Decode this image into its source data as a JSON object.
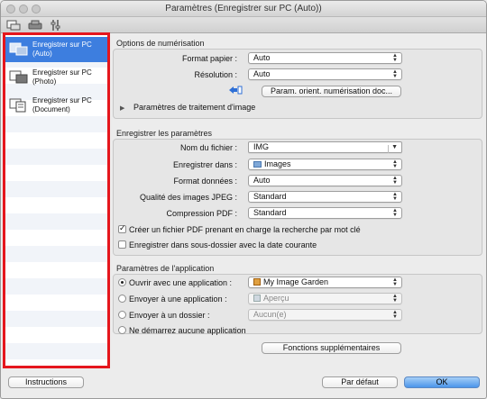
{
  "window": {
    "title": "Paramètres (Enregistrer sur PC (Auto))"
  },
  "sidebar": {
    "items": [
      {
        "label": "Enregistrer sur PC (Auto)",
        "selected": true
      },
      {
        "label": "Enregistrer sur PC (Photo)",
        "selected": false
      },
      {
        "label": "Enregistrer sur PC (Document)",
        "selected": false
      }
    ]
  },
  "scan_options": {
    "title": "Options de numérisation",
    "paper_format_label": "Format papier :",
    "paper_format_value": "Auto",
    "resolution_label": "Résolution :",
    "resolution_value": "Auto",
    "orientation_button": "Param. orient. numérisation doc...",
    "image_processing_label": "Paramètres de traitement d'image"
  },
  "save_settings": {
    "title": "Enregistrer les paramètres",
    "filename_label": "Nom du fichier :",
    "filename_value": "IMG",
    "save_in_label": "Enregistrer dans :",
    "save_in_value": "Images",
    "data_format_label": "Format données :",
    "data_format_value": "Auto",
    "jpeg_quality_label": "Qualité des images JPEG :",
    "jpeg_quality_value": "Standard",
    "pdf_compression_label": "Compression PDF :",
    "pdf_compression_value": "Standard",
    "keyword_pdf_label": "Créer un fichier PDF prenant en charge la recherche par mot clé",
    "keyword_pdf_checked": true,
    "date_subfolder_label": "Enregistrer dans sous-dossier avec la date courante",
    "date_subfolder_checked": false
  },
  "app_settings": {
    "title": "Paramètres de l'application",
    "open_with_label": "Ouvrir avec une application :",
    "open_with_value": "My Image Garden",
    "send_app_label": "Envoyer à une application :",
    "send_app_value": "Aperçu",
    "send_folder_label": "Envoyer à un dossier :",
    "send_folder_value": "Aucun(e)",
    "no_app_label": "Ne démarrez aucune application",
    "selected_option": "open_with",
    "more_functions_button": "Fonctions supplémentaires"
  },
  "footer": {
    "instructions_button": "Instructions",
    "default_button": "Par défaut",
    "ok_button": "OK"
  },
  "colors": {
    "sidebar_highlight": "#e5161d",
    "selection": "#3d7edf"
  }
}
